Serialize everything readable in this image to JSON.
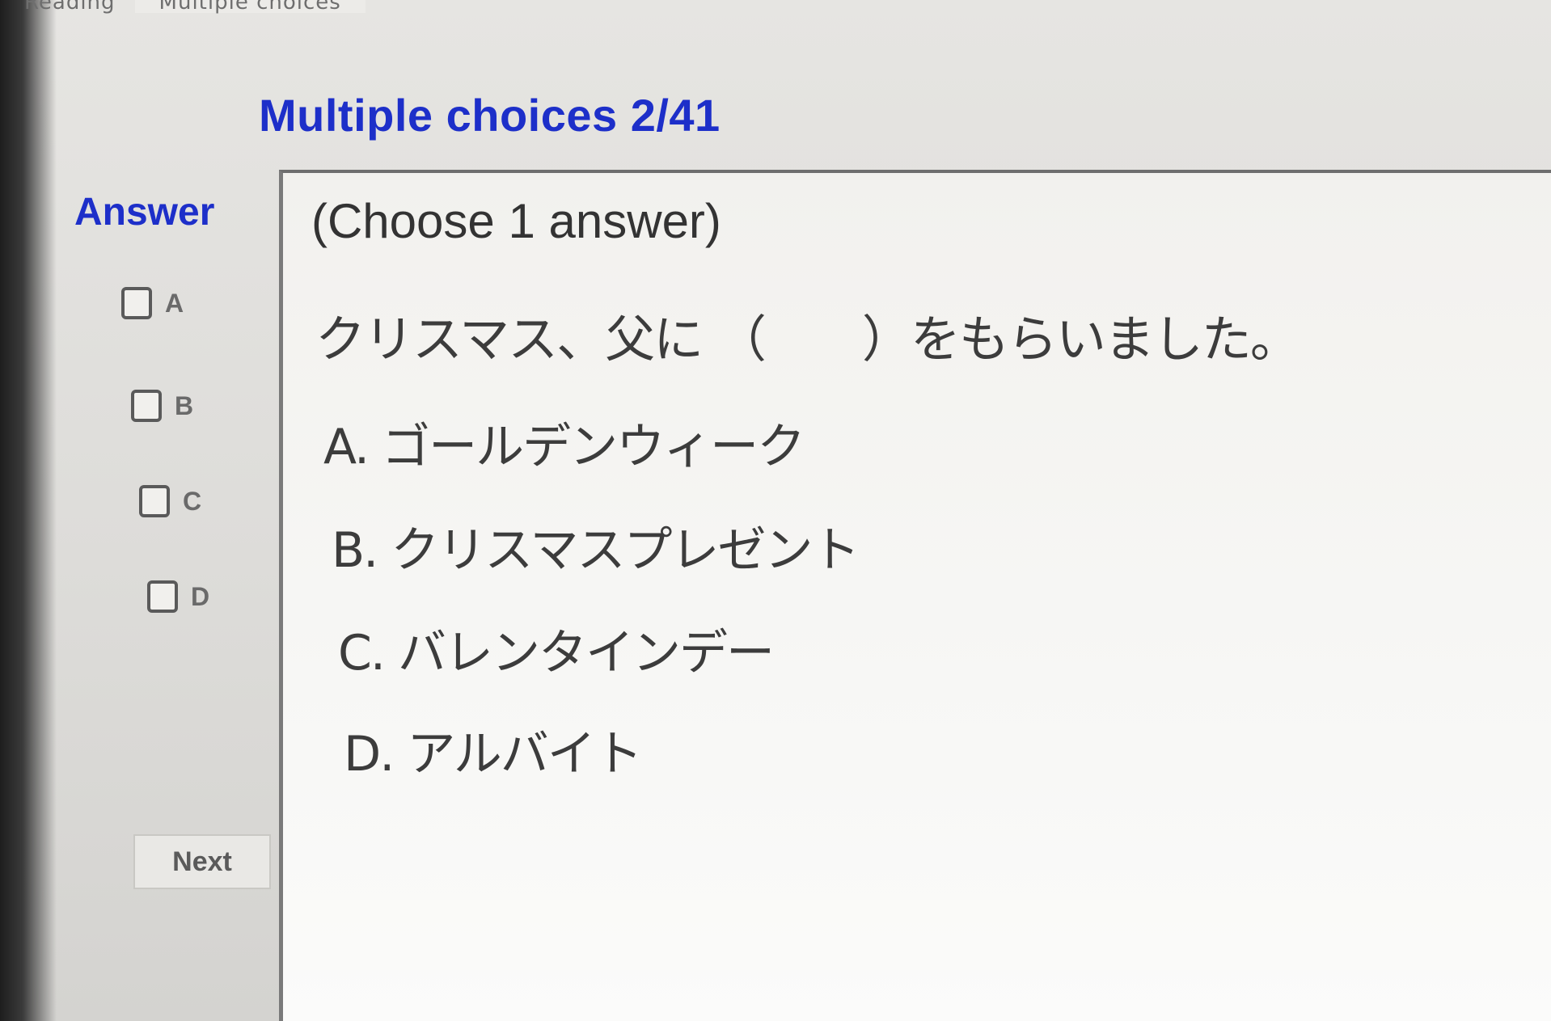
{
  "top_tabs": [
    "Reading",
    "Multiple choices"
  ],
  "header": {
    "title": "Multiple choices 2/41"
  },
  "answer_panel": {
    "heading": "Answer",
    "options": [
      "A",
      "B",
      "C",
      "D"
    ],
    "next_label": "Next"
  },
  "question": {
    "instruction": "(Choose 1 answer)",
    "text": "クリスマス、父に （　　）をもらいました。",
    "choices": [
      "A. ゴールデンウィーク",
      "B. クリスマスプレゼント",
      "C. バレンタインデー",
      "D. アルバイト"
    ]
  },
  "colors": {
    "accent": "#1d2fc9",
    "panel_background": "#f7f7f5",
    "page_background": "#dcdbd8"
  }
}
